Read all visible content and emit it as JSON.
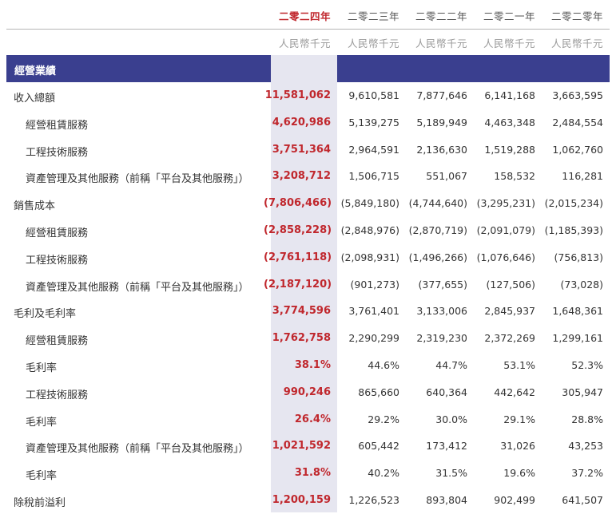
{
  "header": {
    "years": [
      "二零二四年",
      "二零二三年",
      "二零二二年",
      "二零二一年",
      "二零二零年"
    ],
    "units": [
      "人民幣千元",
      "人民幣千元",
      "人民幣千元",
      "人民幣千元",
      "人民幣千元"
    ]
  },
  "section": {
    "title": "經營業績"
  },
  "rows": [
    {
      "label": "收入總額",
      "indent": false,
      "values": [
        "11,581,062",
        "9,610,581",
        "7,877,646",
        "6,141,168",
        "3,663,595"
      ]
    },
    {
      "label": "經營租賃服務",
      "indent": true,
      "values": [
        "4,620,986",
        "5,139,275",
        "5,189,949",
        "4,463,348",
        "2,484,554"
      ]
    },
    {
      "label": "工程技術服務",
      "indent": true,
      "values": [
        "3,751,364",
        "2,964,591",
        "2,136,630",
        "1,519,288",
        "1,062,760"
      ]
    },
    {
      "label": "資產管理及其他服務（前稱「平台及其他服務」）",
      "indent": true,
      "values": [
        "3,208,712",
        "1,506,715",
        "551,067",
        "158,532",
        "116,281"
      ]
    },
    {
      "label": "銷售成本",
      "indent": false,
      "values": [
        "(7,806,466)",
        "(5,849,180)",
        "(4,744,640)",
        "(3,295,231)",
        "(2,015,234)"
      ]
    },
    {
      "label": "經營租賃服務",
      "indent": true,
      "values": [
        "(2,858,228)",
        "(2,848,976)",
        "(2,870,719)",
        "(2,091,079)",
        "(1,185,393)"
      ]
    },
    {
      "label": "工程技術服務",
      "indent": true,
      "values": [
        "(2,761,118)",
        "(2,098,931)",
        "(1,496,266)",
        "(1,076,646)",
        "(756,813)"
      ]
    },
    {
      "label": "資產管理及其他服務（前稱「平台及其他服務」）",
      "indent": true,
      "values": [
        "(2,187,120)",
        "(901,273)",
        "(377,655)",
        "(127,506)",
        "(73,028)"
      ]
    },
    {
      "label": "毛利及毛利率",
      "indent": false,
      "values": [
        "3,774,596",
        "3,761,401",
        "3,133,006",
        "2,845,937",
        "1,648,361"
      ]
    },
    {
      "label": "經營租賃服務",
      "indent": true,
      "values": [
        "1,762,758",
        "2,290,299",
        "2,319,230",
        "2,372,269",
        "1,299,161"
      ]
    },
    {
      "label": "毛利率",
      "indent": true,
      "values": [
        "38.1%",
        "44.6%",
        "44.7%",
        "53.1%",
        "52.3%"
      ]
    },
    {
      "label": "工程技術服務",
      "indent": true,
      "values": [
        "990,246",
        "865,660",
        "640,364",
        "442,642",
        "305,947"
      ]
    },
    {
      "label": "毛利率",
      "indent": true,
      "values": [
        "26.4%",
        "29.2%",
        "30.0%",
        "29.1%",
        "28.8%"
      ]
    },
    {
      "label": "資產管理及其他服務（前稱「平台及其他服務」）",
      "indent": true,
      "values": [
        "1,021,592",
        "605,442",
        "173,412",
        "31,026",
        "43,253"
      ]
    },
    {
      "label": "毛利率",
      "indent": true,
      "values": [
        "31.8%",
        "40.2%",
        "31.5%",
        "19.6%",
        "37.2%"
      ]
    },
    {
      "label": "除稅前溢利",
      "indent": false,
      "values": [
        "1,200,159",
        "1,226,523",
        "893,804",
        "902,499",
        "641,507"
      ]
    }
  ],
  "colors": {
    "accent": "#c0272d",
    "section_bar": "#3a3f8f",
    "highlight_column": "#e6e6f0"
  }
}
